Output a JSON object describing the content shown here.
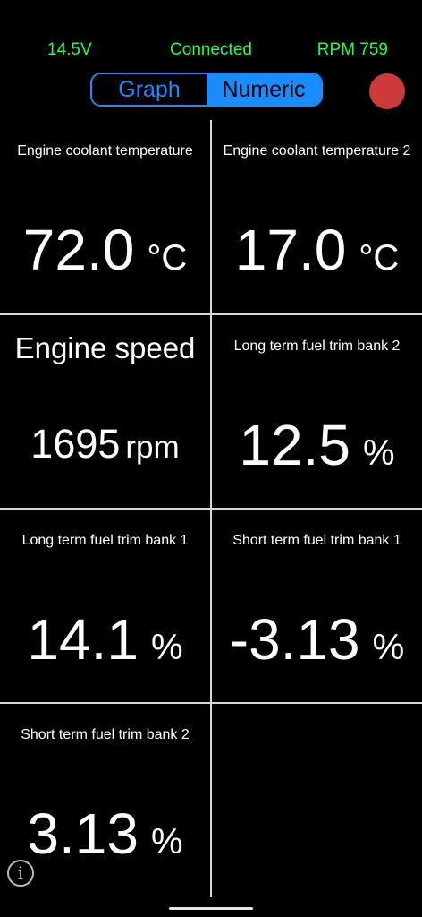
{
  "status": {
    "voltage": "14.5V",
    "connection": "Connected",
    "rpm": "RPM 759",
    "color": "#22ff44"
  },
  "view_toggle": {
    "graph_label": "Graph",
    "numeric_label": "Numeric",
    "selected": "Numeric",
    "accent": "#1a8cff"
  },
  "record_button": {
    "icon": "record-icon",
    "color": "#cc3a3a"
  },
  "gauges": [
    {
      "label": "Engine coolant temperature",
      "value": "72.0",
      "unit": "°C"
    },
    {
      "label": "Engine coolant temperature 2",
      "value": "17.0",
      "unit": "°C"
    },
    {
      "label": "Engine speed",
      "value": "1695",
      "unit": "rpm"
    },
    {
      "label": "Long term fuel trim bank 2",
      "value": "12.5",
      "unit": "%"
    },
    {
      "label": "Long term fuel trim bank 1",
      "value": "14.1",
      "unit": "%"
    },
    {
      "label": "Short term fuel trim bank 1",
      "value": "-3.13",
      "unit": "%"
    },
    {
      "label": "Short term fuel trim bank 2",
      "value": "3.13",
      "unit": "%"
    }
  ],
  "info": {
    "icon": "info-icon",
    "symbol": "i"
  }
}
